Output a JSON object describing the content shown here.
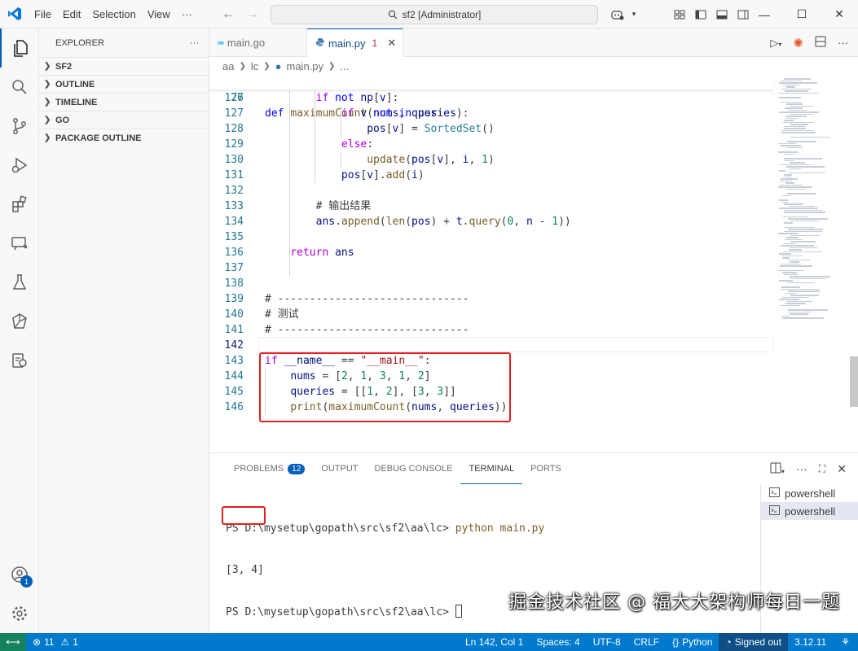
{
  "titlebar": {
    "menus": [
      "File",
      "Edit",
      "Selection",
      "View"
    ],
    "more": "···",
    "search_text": "sf2 [Administrator]"
  },
  "activity_bar": {
    "items": [
      "explorer-icon",
      "search-icon",
      "source-control-icon",
      "run-debug-icon",
      "extensions-icon",
      "remote-explorer-icon",
      "testing-icon",
      "go-icon",
      "database-icon"
    ],
    "account_badge": "1"
  },
  "sidebar": {
    "title": "EXPLORER",
    "more": "···",
    "sections": [
      "SF2",
      "OUTLINE",
      "TIMELINE",
      "GO",
      "PACKAGE OUTLINE"
    ]
  },
  "tabs": [
    {
      "label": "main.go",
      "active": false
    },
    {
      "label": "main.py",
      "active": true,
      "problems": "1"
    }
  ],
  "breadcrumb": [
    "aa",
    "lc",
    "main.py",
    "..."
  ],
  "editor": {
    "sticky": {
      "number": "77",
      "code": "def maximumCount(nums, queries):"
    },
    "lines": [
      {
        "n": "126",
        "code": "        if not np[v]:"
      },
      {
        "n": "127",
        "code": "            if v not in pos:"
      },
      {
        "n": "128",
        "code": "                pos[v] = SortedSet()"
      },
      {
        "n": "129",
        "code": "            else:"
      },
      {
        "n": "130",
        "code": "                update(pos[v], i, 1)"
      },
      {
        "n": "131",
        "code": "            pos[v].add(i)"
      },
      {
        "n": "132",
        "code": ""
      },
      {
        "n": "133",
        "code": "        # 输出结果"
      },
      {
        "n": "134",
        "code": "        ans.append(len(pos) + t.query(0, n - 1))"
      },
      {
        "n": "135",
        "code": ""
      },
      {
        "n": "136",
        "code": "    return ans"
      },
      {
        "n": "137",
        "code": ""
      },
      {
        "n": "138",
        "code": ""
      },
      {
        "n": "139",
        "code": "# ------------------------------"
      },
      {
        "n": "140",
        "code": "# 测试"
      },
      {
        "n": "141",
        "code": "# ------------------------------"
      },
      {
        "n": "142",
        "code": ""
      },
      {
        "n": "143",
        "code": "if __name__ == \"__main__\":"
      },
      {
        "n": "144",
        "code": "    nums = [2, 1, 3, 1, 2]"
      },
      {
        "n": "145",
        "code": "    queries = [[1, 2], [3, 3]]"
      },
      {
        "n": "146",
        "code": "    print(maximumCount(nums, queries))"
      }
    ]
  },
  "panel": {
    "tabs": [
      "PROBLEMS",
      "OUTPUT",
      "DEBUG CONSOLE",
      "TERMINAL",
      "PORTS"
    ],
    "problems_count": "12",
    "active_tab": "TERMINAL",
    "terminal": {
      "prompt1": "PS D:\\mysetup\\gopath\\src\\sf2\\aa\\lc> ",
      "command": "python main.py",
      "output": "[3, 4]",
      "prompt2": "PS D:\\mysetup\\gopath\\src\\sf2\\aa\\lc> "
    },
    "terminal_list": [
      "powershell",
      "powershell"
    ]
  },
  "watermark": "掘金技术社区 @ 福大大架构师每日一题",
  "statusbar": {
    "errors": "11",
    "warnings": "1",
    "position": "Ln 142, Col 1",
    "spaces": "Spaces: 4",
    "encoding": "UTF-8",
    "eol": "CRLF",
    "language": "Python",
    "signed": "Signed out",
    "version": "3.12.11"
  },
  "colors": {
    "accent": "#005fb8",
    "statusbar": "#007acc",
    "highlight_box": "#e02020"
  }
}
